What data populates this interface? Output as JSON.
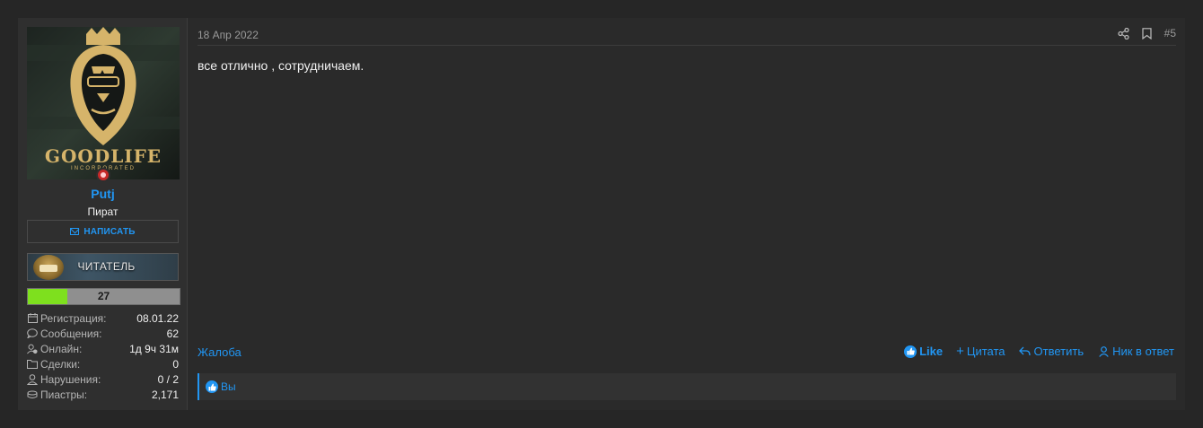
{
  "author": {
    "username": "Putj",
    "user_title": "Пират",
    "avatar_text": "GOODLIFE",
    "avatar_subtext": "INCORPORATED",
    "online_status_color": "#c62828",
    "write_button_label": "НАПИСАТЬ",
    "rank_banner_label": "ЧИТАТЕЛЬ",
    "level": {
      "value": "27",
      "progress_fraction": 0.26,
      "fill_color": "#7ee01e"
    },
    "stats": [
      {
        "icon": "calendar-icon",
        "label": "Регистрация:",
        "value": "08.01.22"
      },
      {
        "icon": "comment-icon",
        "label": "Сообщения:",
        "value": "62"
      },
      {
        "icon": "user-clock-icon",
        "label": "Онлайн:",
        "value": "1д 9ч 31м"
      },
      {
        "icon": "folder-icon",
        "label": "Сделки:",
        "value": "0"
      },
      {
        "icon": "user-shield-icon",
        "label": "Нарушения:",
        "value": "0 / 2"
      },
      {
        "icon": "coins-icon",
        "label": "Пиастры:",
        "value": "2,171"
      }
    ]
  },
  "post": {
    "date": "18 Апр 2022",
    "number": "#5",
    "body": "все отлично , сотрудничаем.",
    "report_label": "Жалоба",
    "actions": {
      "like": "Like",
      "quote": "Цитата",
      "reply": "Ответить",
      "mention": "Ник в ответ"
    },
    "likes_text": "Вы"
  },
  "colors": {
    "accent": "#2196f3",
    "background": "#262626",
    "panel": "#2a2a2a"
  }
}
